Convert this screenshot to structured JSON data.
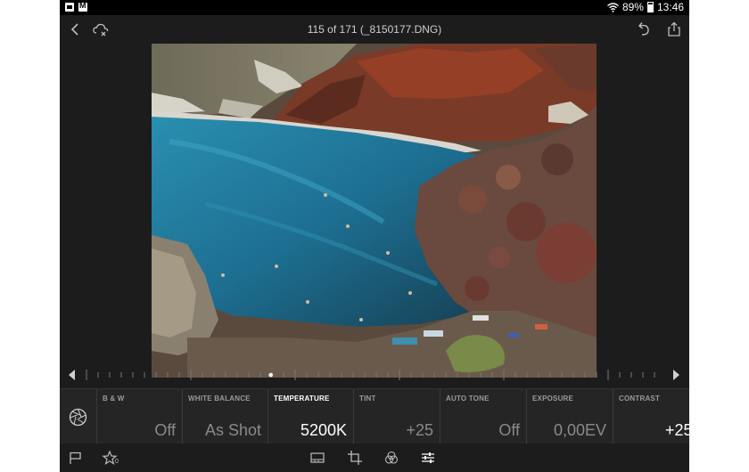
{
  "statusbar": {
    "battery": "89%",
    "time": "13:46",
    "left_icons": [
      "gallery-icon",
      "gmail-icon"
    ],
    "right_icons": [
      "wifi-icon",
      "battery-icon"
    ]
  },
  "header": {
    "title": "115 of 171 (_8150177.DNG)",
    "icons": [
      "back-chevron-icon",
      "cloud-sync-icon",
      "undo-icon",
      "share-icon"
    ]
  },
  "adjustments": [
    {
      "label": "B & W",
      "value": "Off",
      "active": false
    },
    {
      "label": "WHITE BALANCE",
      "value": "As Shot",
      "active": false
    },
    {
      "label": "TEMPERATURE",
      "value": "5200K",
      "active": true
    },
    {
      "label": "TINT",
      "value": "+25",
      "active": false
    },
    {
      "label": "AUTO TONE",
      "value": "Off",
      "active": false
    },
    {
      "label": "EXPOSURE",
      "value": "0,00EV",
      "active": false
    },
    {
      "label": "CONTRAST",
      "value": "+25",
      "active": false
    }
  ],
  "slider": {
    "position": 0.32
  },
  "bottombar": {
    "rating_text": "0",
    "icons": [
      "flag-icon",
      "star-icon",
      "filmstrip-icon",
      "crop-icon",
      "presets-icon",
      "sliders-icon"
    ]
  },
  "colors": {
    "panel": "#1c1c1c",
    "adjust_bar": "#252525",
    "active_text": "#ffffff",
    "inactive_text": "#8a8a8a"
  }
}
